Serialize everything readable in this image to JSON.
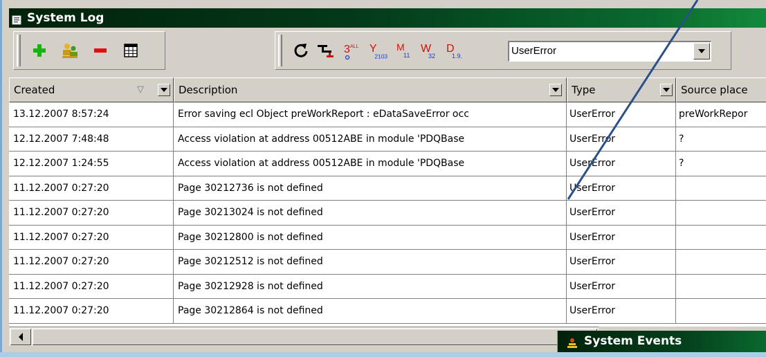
{
  "window": {
    "title": "System Log"
  },
  "toolbar": {
    "buttons": [
      {
        "name": "add-icon",
        "color": "#19b30f"
      },
      {
        "name": "users-icon",
        "color": "#c89a1a"
      },
      {
        "name": "remove-icon",
        "color": "#e01010"
      },
      {
        "name": "grid-icon",
        "color": "#000000"
      }
    ],
    "filter_buttons": [
      {
        "name": "refresh-icon"
      },
      {
        "name": "filter-tree-icon"
      },
      {
        "name": "filter-all-icon",
        "sup": "ALL",
        "sub": "",
        "letter": "3"
      },
      {
        "name": "filter-year-icon",
        "letter": "Y",
        "sub": "2103"
      },
      {
        "name": "filter-month-icon",
        "letter": "M",
        "sub": "11"
      },
      {
        "name": "filter-week-icon",
        "letter": "W",
        "sub": "32"
      },
      {
        "name": "filter-day-icon",
        "letter": "D",
        "sub": "1.9."
      }
    ],
    "type_filter": {
      "value": "UserError"
    }
  },
  "table": {
    "columns": [
      {
        "key": "created",
        "label": "Created"
      },
      {
        "key": "description",
        "label": "Description"
      },
      {
        "key": "type",
        "label": "Type"
      },
      {
        "key": "source",
        "label": "Source place"
      }
    ],
    "rows": [
      {
        "created": "13.12.2007 8:57:24",
        "description": "Error saving ecl Object preWorkReport : eDataSaveError occ",
        "type": "UserError",
        "source": "preWorkRepor"
      },
      {
        "created": "12.12.2007 7:48:48",
        "description": "Access violation at address 00512ABE in module 'PDQBase",
        "type": "UserError",
        "source": "?"
      },
      {
        "created": "12.12.2007 1:24:55",
        "description": "Access violation at address 00512ABE in module 'PDQBase",
        "type": "UserError",
        "source": "?"
      },
      {
        "created": "11.12.2007 0:27:20",
        "description": "Page 30212736 is not defined",
        "type": "UserError",
        "source": ""
      },
      {
        "created": "11.12.2007 0:27:20",
        "description": "Page 30213024 is not defined",
        "type": "UserError",
        "source": ""
      },
      {
        "created": "11.12.2007 0:27:20",
        "description": "Page 30212800 is not defined",
        "type": "UserError",
        "source": ""
      },
      {
        "created": "11.12.2007 0:27:20",
        "description": "Page 30212512 is not defined",
        "type": "UserError",
        "source": ""
      },
      {
        "created": "11.12.2007 0:27:20",
        "description": "Page 30212928 is not defined",
        "type": "UserError",
        "source": ""
      },
      {
        "created": "11.12.2007 0:27:20",
        "description": "Page 30212864 is not defined",
        "type": "UserError",
        "source": ""
      }
    ]
  },
  "second_window": {
    "title": "System Events"
  },
  "colors": {
    "title_bar": "#03391a",
    "annotation_line": "#2b4f8a"
  }
}
